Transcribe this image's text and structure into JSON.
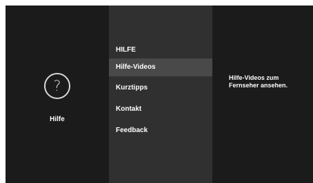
{
  "left": {
    "icon": "question-mark-icon",
    "icon_glyph": "?",
    "label": "Hilfe"
  },
  "menu": {
    "heading": "HILFE",
    "items": [
      {
        "label": "Hilfe-Videos",
        "selected": true
      },
      {
        "label": "Kurztipps",
        "selected": false
      },
      {
        "label": "Kontakt",
        "selected": false
      },
      {
        "label": "Feedback",
        "selected": false
      }
    ]
  },
  "detail": {
    "line1": "Hilfe-Videos zum",
    "line2": "Fernseher ansehen."
  },
  "colors": {
    "background": "#1b1b1b",
    "menu_background": "#303030",
    "selected_item": "#494949",
    "text": "#ffffff"
  }
}
